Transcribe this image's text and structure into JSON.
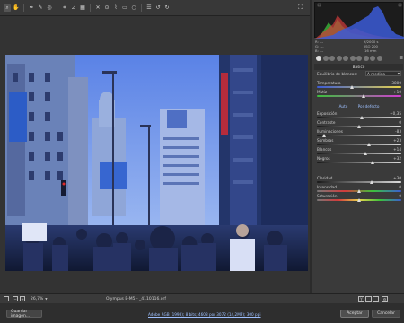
{
  "toolbar": {
    "tools": [
      "zoom-icon",
      "hand-icon",
      "white-balance-icon",
      "color-sampler-icon",
      "target-adjust-icon",
      "crop-icon",
      "straighten-icon",
      "transform-icon",
      "spot-removal-icon",
      "red-eye-icon",
      "adjustment-brush-icon",
      "graduated-filter-icon",
      "radial-filter-icon",
      "preferences-icon",
      "rotate-left-icon",
      "rotate-right-icon"
    ]
  },
  "histogram": {
    "colors": {
      "red": "#d23b3b",
      "green": "#3bc13b",
      "blue": "#3b5bd6"
    }
  },
  "info": {
    "r": "R:",
    "g": "G:",
    "b": "B:",
    "r_val": "---",
    "g_val": "---",
    "b_val": "---",
    "exposure": "f/2000 s",
    "iso_line": "ISO 200",
    "focal": "16 mm"
  },
  "panel": {
    "title": "Básico",
    "wb_label": "Equilibrio de blancos:",
    "wb_value": "A medida",
    "auto": "Auto",
    "default": "Por defecto",
    "sliders": [
      {
        "label": "Temperatura",
        "value": "3800",
        "pos": 0.42,
        "color": "temp"
      },
      {
        "label": "Matiz",
        "value": "+10",
        "pos": 0.55,
        "color": "tint"
      },
      {
        "label": "Exposición",
        "value": "+0,35",
        "pos": 0.53,
        "color": "gray"
      },
      {
        "label": "Contraste",
        "value": "0",
        "pos": 0.5,
        "color": "gray"
      },
      {
        "label": "Iluminaciones",
        "value": "-83",
        "pos": 0.08,
        "color": "gray"
      },
      {
        "label": "Sombras",
        "value": "+23",
        "pos": 0.62,
        "color": "gray"
      },
      {
        "label": "Blancos",
        "value": "+14",
        "pos": 0.57,
        "color": "gray"
      },
      {
        "label": "Negros",
        "value": "+32",
        "pos": 0.66,
        "color": "gray"
      },
      {
        "label": "Claridad",
        "value": "+30",
        "pos": 0.65,
        "color": "gray"
      },
      {
        "label": "Intensidad",
        "value": "0",
        "pos": 0.5,
        "color": "vib"
      },
      {
        "label": "Saturación",
        "value": "0",
        "pos": 0.5,
        "color": "sat"
      }
    ]
  },
  "status": {
    "zoom": "26,7%",
    "filename": "Olympus E-M5 - _4110116.orf",
    "workflow": "Adobe RGB (1998); 8 bits; 4608 por 3072 (14,2MP); 300 ppi"
  },
  "footer": {
    "save": "Guardar imagen...",
    "accept": "Aceptar",
    "cancel": "Cancelar"
  },
  "colors": {
    "sky": "#4a6fd6",
    "accent": "#5b8ed6"
  }
}
